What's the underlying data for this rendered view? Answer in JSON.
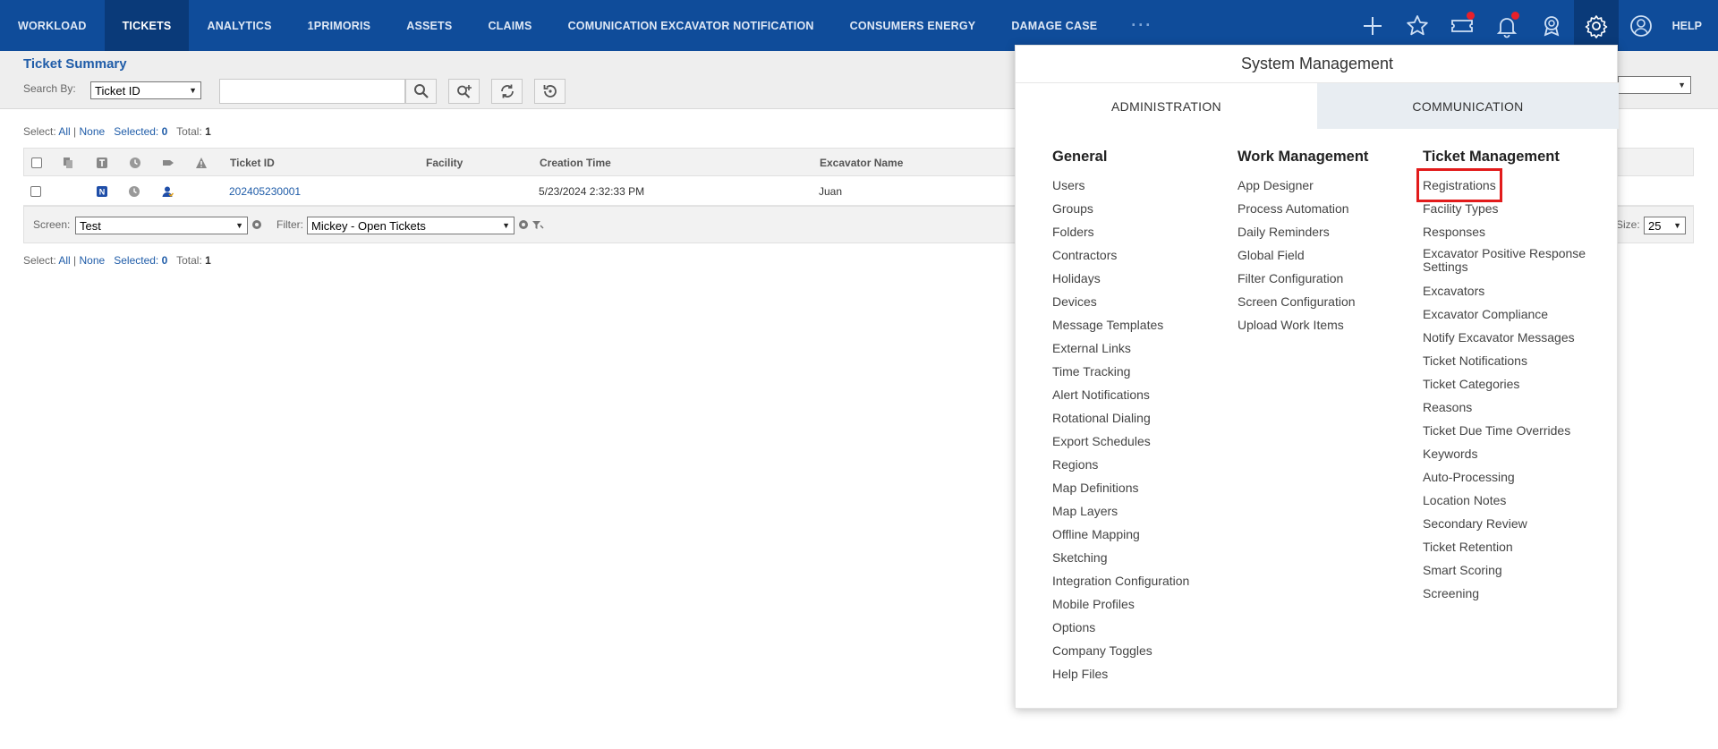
{
  "nav": {
    "items": [
      {
        "label": "WORKLOAD",
        "active": false
      },
      {
        "label": "TICKETS",
        "active": true
      },
      {
        "label": "ANALYTICS",
        "active": false
      },
      {
        "label": "1PRIMORIS",
        "active": false
      },
      {
        "label": "ASSETS",
        "active": false
      },
      {
        "label": "CLAIMS",
        "active": false
      },
      {
        "label": "COMUNICATION EXCAVATOR NOTIFICATION",
        "active": false
      },
      {
        "label": "CONSUMERS ENERGY",
        "active": false
      },
      {
        "label": "DAMAGE CASE",
        "active": false
      }
    ],
    "more": "···",
    "help": "HELP",
    "icons": [
      "plus-icon",
      "star-icon",
      "ticket-icon",
      "bell-icon",
      "award-icon",
      "gear-icon",
      "user-icon"
    ],
    "brand_color": "#0f4c9a",
    "active_color": "#0a3a79"
  },
  "page": {
    "title": "Ticket Summary",
    "search_by_label": "Search By:",
    "search_by_value": "Ticket ID",
    "search_value": ""
  },
  "selection": {
    "select_label": "Select:",
    "all": "All",
    "sep": "|",
    "none": "None",
    "selected_label": "Selected:",
    "selected_count": "0",
    "total_label": "Total:",
    "total_count": "1"
  },
  "grid": {
    "headers": {
      "ticket_id": "Ticket ID",
      "facility": "Facility",
      "creation_time": "Creation Time",
      "excavator_name": "Excavator Name"
    },
    "rows": [
      {
        "type_badge": "N",
        "ticket_id": "202405230001",
        "facility": "",
        "creation_time": "5/23/2024 2:32:33 PM",
        "excavator_name": "Juan"
      }
    ],
    "footer": {
      "screen_label": "Screen:",
      "screen_value": "Test",
      "filter_label": "Filter:",
      "filter_value": "Mickey - Open Tickets",
      "size_label": "Size:",
      "size_value": "25"
    }
  },
  "system_management": {
    "title": "System Management",
    "tabs": [
      {
        "label": "ADMINISTRATION",
        "active": true
      },
      {
        "label": "COMMUNICATION",
        "active": false
      }
    ],
    "columns": [
      {
        "heading": "General",
        "items": [
          "Users",
          "Groups",
          "Folders",
          "Contractors",
          "Holidays",
          "Devices",
          "Message Templates",
          "External Links",
          "Time Tracking",
          "Alert Notifications",
          "Rotational Dialing",
          "Export Schedules",
          "Regions",
          "Map Definitions",
          "Map Layers",
          "Offline Mapping",
          "Sketching",
          "Integration Configuration",
          "Mobile Profiles",
          "Options",
          "Company Toggles",
          "Help Files"
        ]
      },
      {
        "heading": "Work Management",
        "items": [
          "App Designer",
          "Process Automation",
          "Daily Reminders",
          "Global Field",
          "Filter Configuration",
          "Screen Configuration",
          "Upload Work Items"
        ]
      },
      {
        "heading": "Ticket Management",
        "highlighted": "Registrations",
        "items": [
          "Registrations",
          "Facility Types",
          "Responses",
          "Excavator Positive Response Settings",
          "Excavators",
          "Excavator Compliance",
          "Notify Excavator Messages",
          "Ticket Notifications",
          "Ticket Categories",
          "Reasons",
          "Ticket Due Time Overrides",
          "Keywords",
          "Auto-Processing",
          "Location Notes",
          "Secondary Review",
          "Ticket Retention",
          "Smart Scoring",
          "Screening"
        ]
      }
    ],
    "highlight_color": "#e21b1b"
  }
}
